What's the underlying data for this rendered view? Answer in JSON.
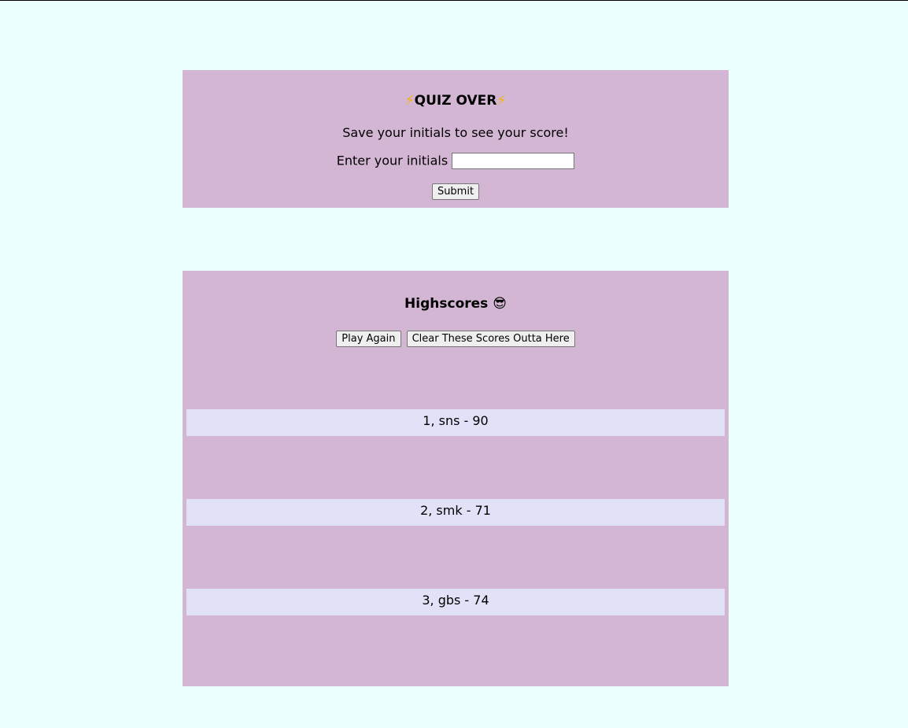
{
  "quiz_over": {
    "bolt_icon": "⚡",
    "title": "QUIZ OVER",
    "message": "Save your initials to see your score!",
    "initials_label": "Enter your initials",
    "initials_value": "",
    "submit_label": "Submit"
  },
  "highscores": {
    "title": "Highscores",
    "emoji": "😎",
    "play_again_label": "Play Again",
    "clear_label": "Clear These Scores Outta Here",
    "scores": [
      "1, sns - 90",
      "2, smk - 71",
      "3, gbs - 74"
    ]
  },
  "colors": {
    "page_background": "#ebffff",
    "panel_background": "#d3b6d3",
    "score_row_background": "#e1e1f8"
  }
}
